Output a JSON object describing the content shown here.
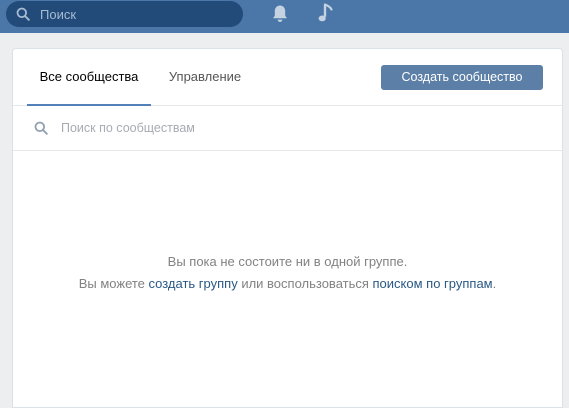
{
  "top_bar": {
    "search_placeholder": "Поиск",
    "icons": [
      "search-icon",
      "bell-icon",
      "music-icon"
    ],
    "color": "#4a76a8"
  },
  "tabs": [
    {
      "label": "Все сообщества",
      "active": true
    },
    {
      "label": "Управление",
      "active": false
    }
  ],
  "create_button": {
    "label": "Создать сообщество",
    "color": "#5b7fa7"
  },
  "community_search": {
    "placeholder": "Поиск по сообществам"
  },
  "empty_state": {
    "line1": "Вы пока не состоите ни в одной группе.",
    "line2_prefix": "Вы можете ",
    "create_group_link": "создать группу",
    "line2_middle": " или воспользоваться ",
    "search_groups_link": "поиском по группам",
    "line2_suffix": "."
  },
  "colors": {
    "accent": "#5181b8",
    "link": "#2a5885",
    "background": "#edeef0"
  }
}
